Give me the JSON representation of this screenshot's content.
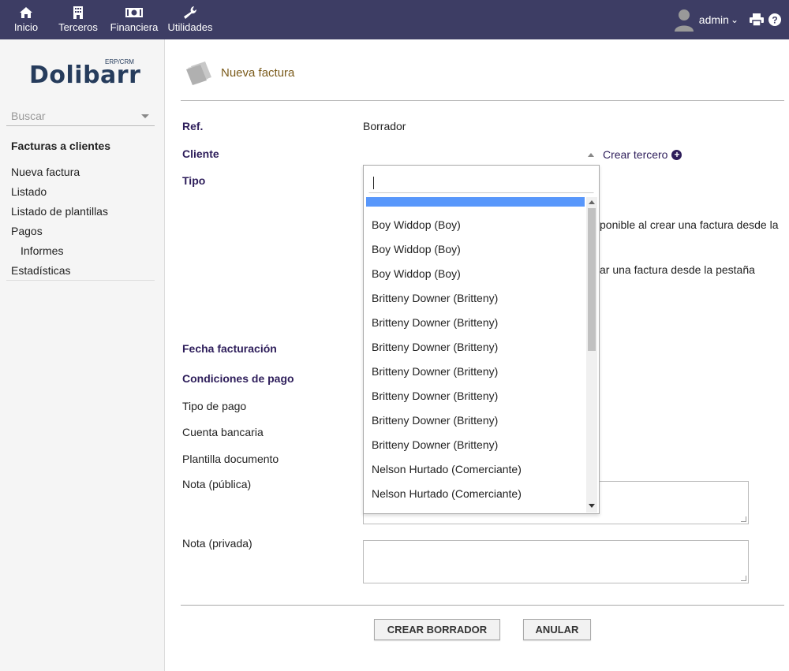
{
  "topmenu": [
    {
      "label": "Inicio",
      "icon": "home-icon"
    },
    {
      "label": "Terceros",
      "icon": "building-icon"
    },
    {
      "label": "Financiera",
      "icon": "money-icon"
    },
    {
      "label": "Utilidades",
      "icon": "wrench-icon"
    }
  ],
  "user": {
    "name": "admin"
  },
  "sidebar": {
    "logo": "Dolibarr",
    "logo_sub": "ERP/CRM",
    "search_placeholder": "Buscar",
    "section_title": "Facturas a clientes",
    "items": [
      {
        "label": "Nueva factura"
      },
      {
        "label": "Listado"
      },
      {
        "label": "Listado de plantillas"
      },
      {
        "label": "Pagos"
      },
      {
        "label": "Informes"
      },
      {
        "label": "Estadísticas"
      }
    ]
  },
  "page": {
    "title": "Nueva factura",
    "ref_label": "Ref.",
    "ref_value": "Borrador",
    "cliente_label": "Cliente",
    "crear_tercero": "Crear tercero",
    "tipo_label": "Tipo",
    "tipo_text1": "ponible al crear una factura desde la",
    "tipo_text2": "ar una factura desde la pestaña",
    "fecha_label": "Fecha facturación",
    "condiciones_label": "Condiciones de pago",
    "tipo_pago_label": "Tipo de pago",
    "cuenta_label": "Cuenta bancaria",
    "plantilla_label": "Plantilla documento",
    "nota_publica_label": "Nota (pública)",
    "nota_privada_label": "Nota (privada)",
    "crear_borrador": "CREAR BORRADOR",
    "anular": "ANULAR"
  },
  "dropdown": {
    "options": [
      "Boy Widdop (Boy)",
      "Boy Widdop (Boy)",
      "Boy Widdop (Boy)",
      "Britteny Downer (Britteny)",
      "Britteny Downer (Britteny)",
      "Britteny Downer (Britteny)",
      "Britteny Downer (Britteny)",
      "Britteny Downer (Britteny)",
      "Britteny Downer (Britteny)",
      "Britteny Downer (Britteny)",
      "Nelson Hurtado (Comerciante)",
      "Nelson Hurtado (Comerciante)",
      "Nelson Hurtado (Comerciante)"
    ]
  },
  "colors": {
    "topbar": "#3d3d64",
    "label": "#2d1d5a",
    "title": "#7a5a1a",
    "highlight": "#5897fb"
  }
}
